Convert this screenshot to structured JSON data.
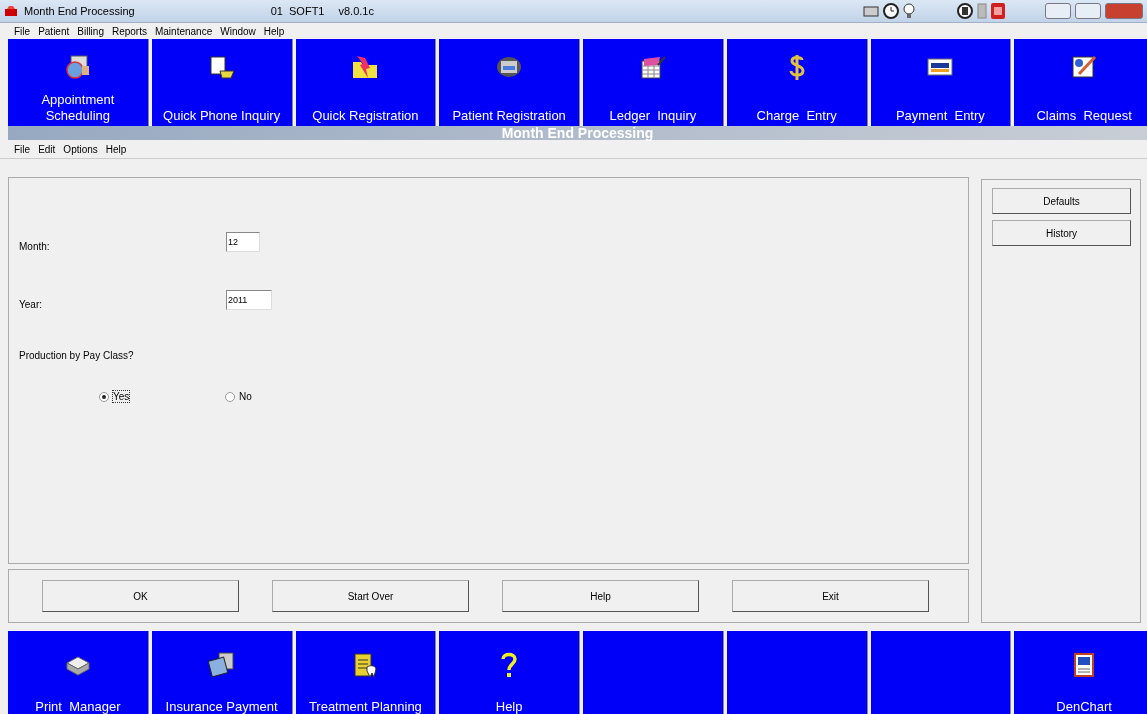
{
  "window": {
    "title": "Month End Processing",
    "company": "01  SOFT1",
    "version": "v8.0.1c"
  },
  "menu": [
    "File",
    "Patient",
    "Billing",
    "Reports",
    "Maintenance",
    "Window",
    "Help"
  ],
  "toolbar": [
    {
      "kind": "tool",
      "label": "Appointment Scheduling"
    },
    {
      "kind": "tool",
      "label": "Quick Phone Inquiry"
    },
    {
      "kind": "tool",
      "label": "Quick Registration"
    },
    {
      "kind": "tool",
      "label": "Patient Registration"
    },
    {
      "kind": "tool",
      "label": "Ledger  Inquiry"
    },
    {
      "kind": "tool",
      "label": "Charge  Entry"
    },
    {
      "kind": "tool",
      "label": "Payment  Entry"
    },
    {
      "kind": "tool",
      "label": "Claims  Request"
    }
  ],
  "form_title": "Month End Processing",
  "form_menu": [
    "File",
    "Edit",
    "Options",
    "Help"
  ],
  "fields": [
    {
      "label": "Month:",
      "value": "12"
    },
    {
      "label": "Year:",
      "value": "2011"
    }
  ],
  "question": "Production by Pay Class?",
  "options": [
    {
      "label": "Yes",
      "selected": true
    },
    {
      "label": "No",
      "selected": false
    }
  ],
  "buttons": [
    "OK",
    "Start Over",
    "Help",
    "Exit"
  ],
  "side_buttons": [
    "Defaults",
    "History"
  ],
  "bottom_toolbar": [
    {
      "kind": "tool",
      "label": "Print  Manager"
    },
    {
      "kind": "tool",
      "label": "Insurance Payment"
    },
    {
      "kind": "tool",
      "label": "Treatment Planning"
    },
    {
      "kind": "tool",
      "label": "Help"
    },
    {
      "kind": "empty"
    },
    {
      "kind": "empty"
    },
    {
      "kind": "empty"
    },
    {
      "kind": "tool",
      "label": "DenChart"
    }
  ]
}
